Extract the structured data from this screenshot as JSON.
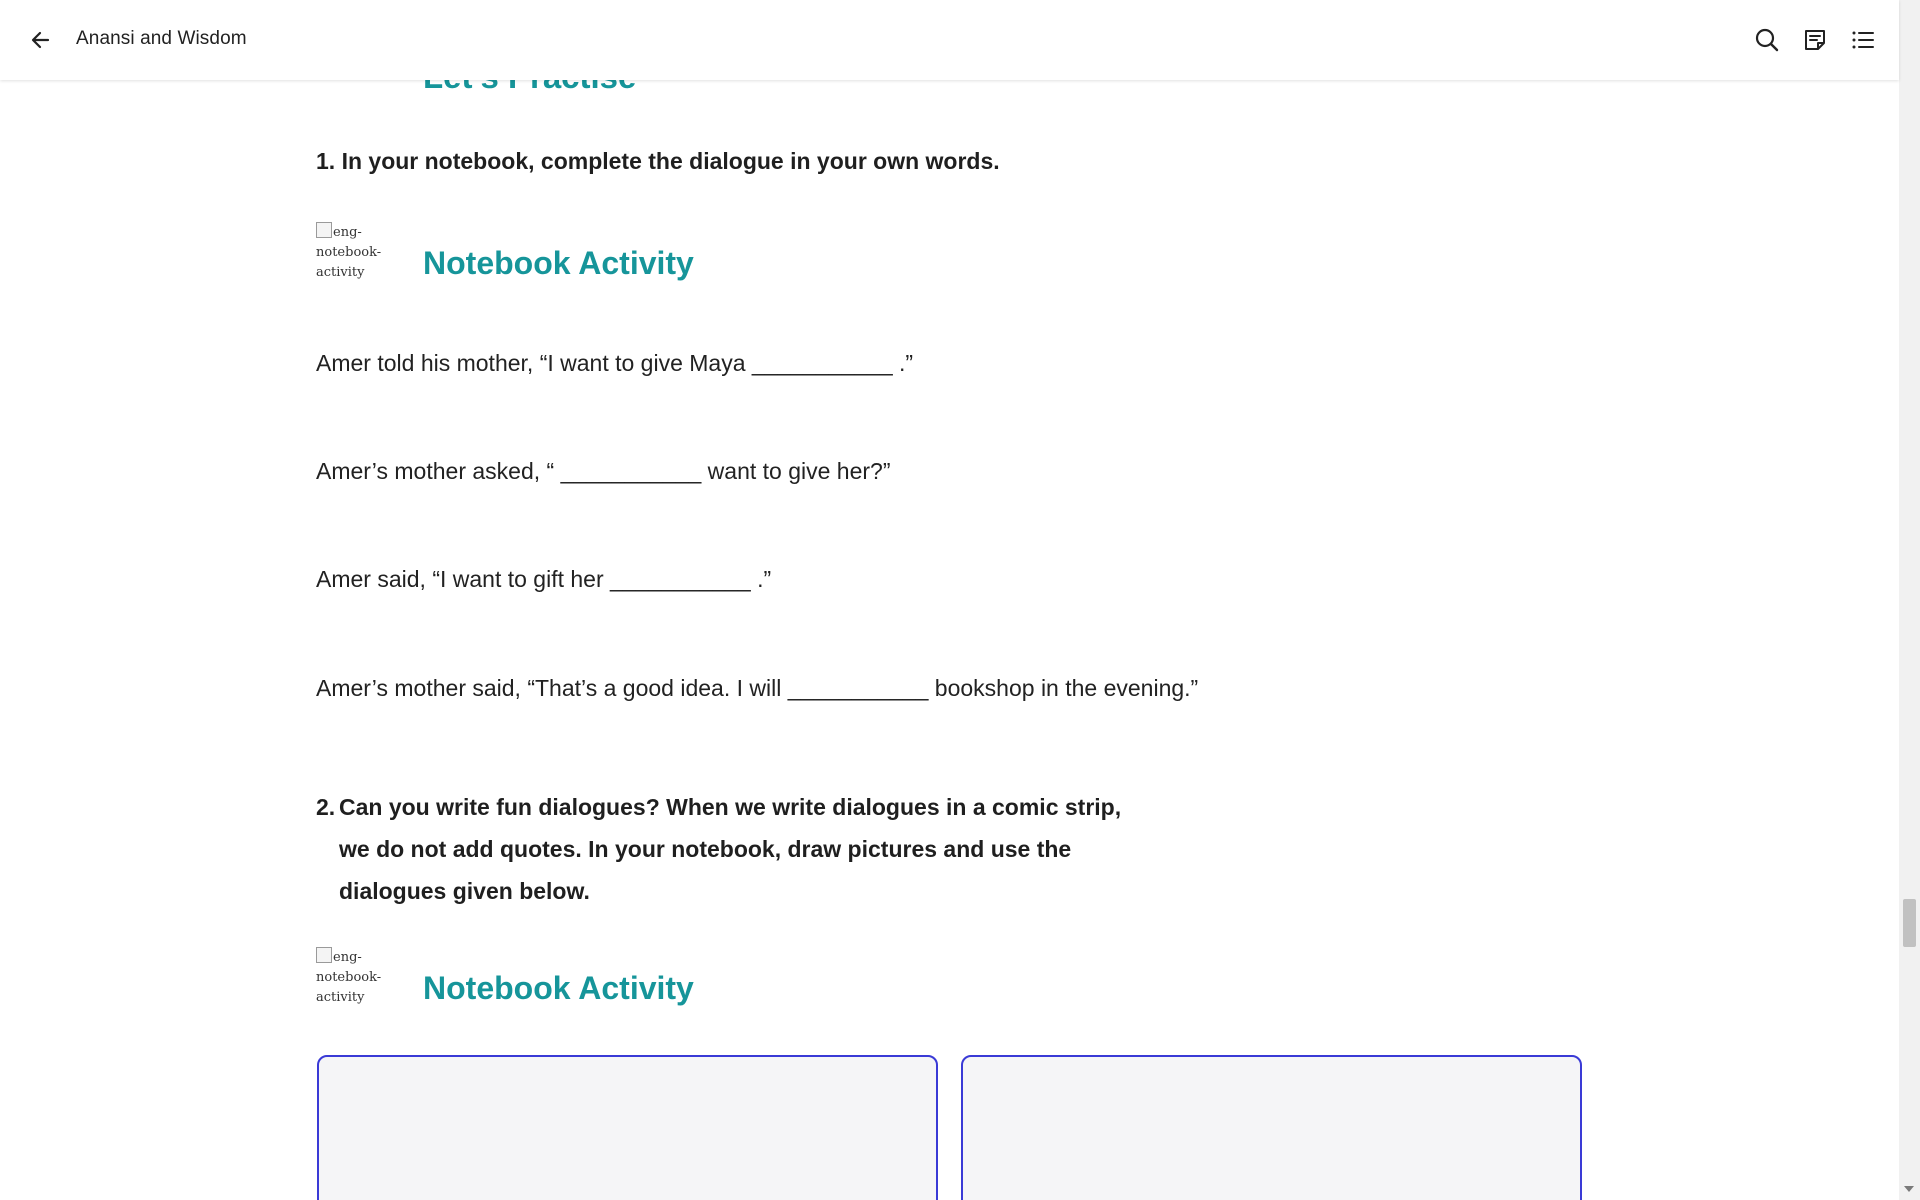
{
  "header": {
    "title": "Anansi and Wisdom",
    "icons": [
      "back-arrow-icon",
      "search-icon",
      "notes-icon",
      "toc-list-icon"
    ]
  },
  "section": {
    "heading": "Let’s Practise"
  },
  "question1": {
    "text": "1. In your notebook, complete the dialogue in your own words."
  },
  "activity1": {
    "img_alt": "eng-notebook-activity",
    "title": "Notebook Activity"
  },
  "dialogues": [
    "Amer told his mother, “I want to give Maya ___________ .”",
    "Amer’s mother asked, “ ___________ want to give her?”",
    "Amer said, “I want to gift her ___________ .”",
    "Amer’s mother said, “That’s a good idea. I will ___________ bookshop in the evening.”"
  ],
  "question2": {
    "number": "2.",
    "text": "Can you write fun dialogues? When we write dialogues in a comic strip, we do not add quotes. In your notebook, draw pictures and use the dialogues given below."
  },
  "activity2": {
    "img_alt": "eng-notebook-activity",
    "title": "Notebook Activity"
  },
  "colors": {
    "accent_teal": "#16959a",
    "panel_border": "#3a3ad6",
    "panel_bg": "#f5f5f7"
  }
}
